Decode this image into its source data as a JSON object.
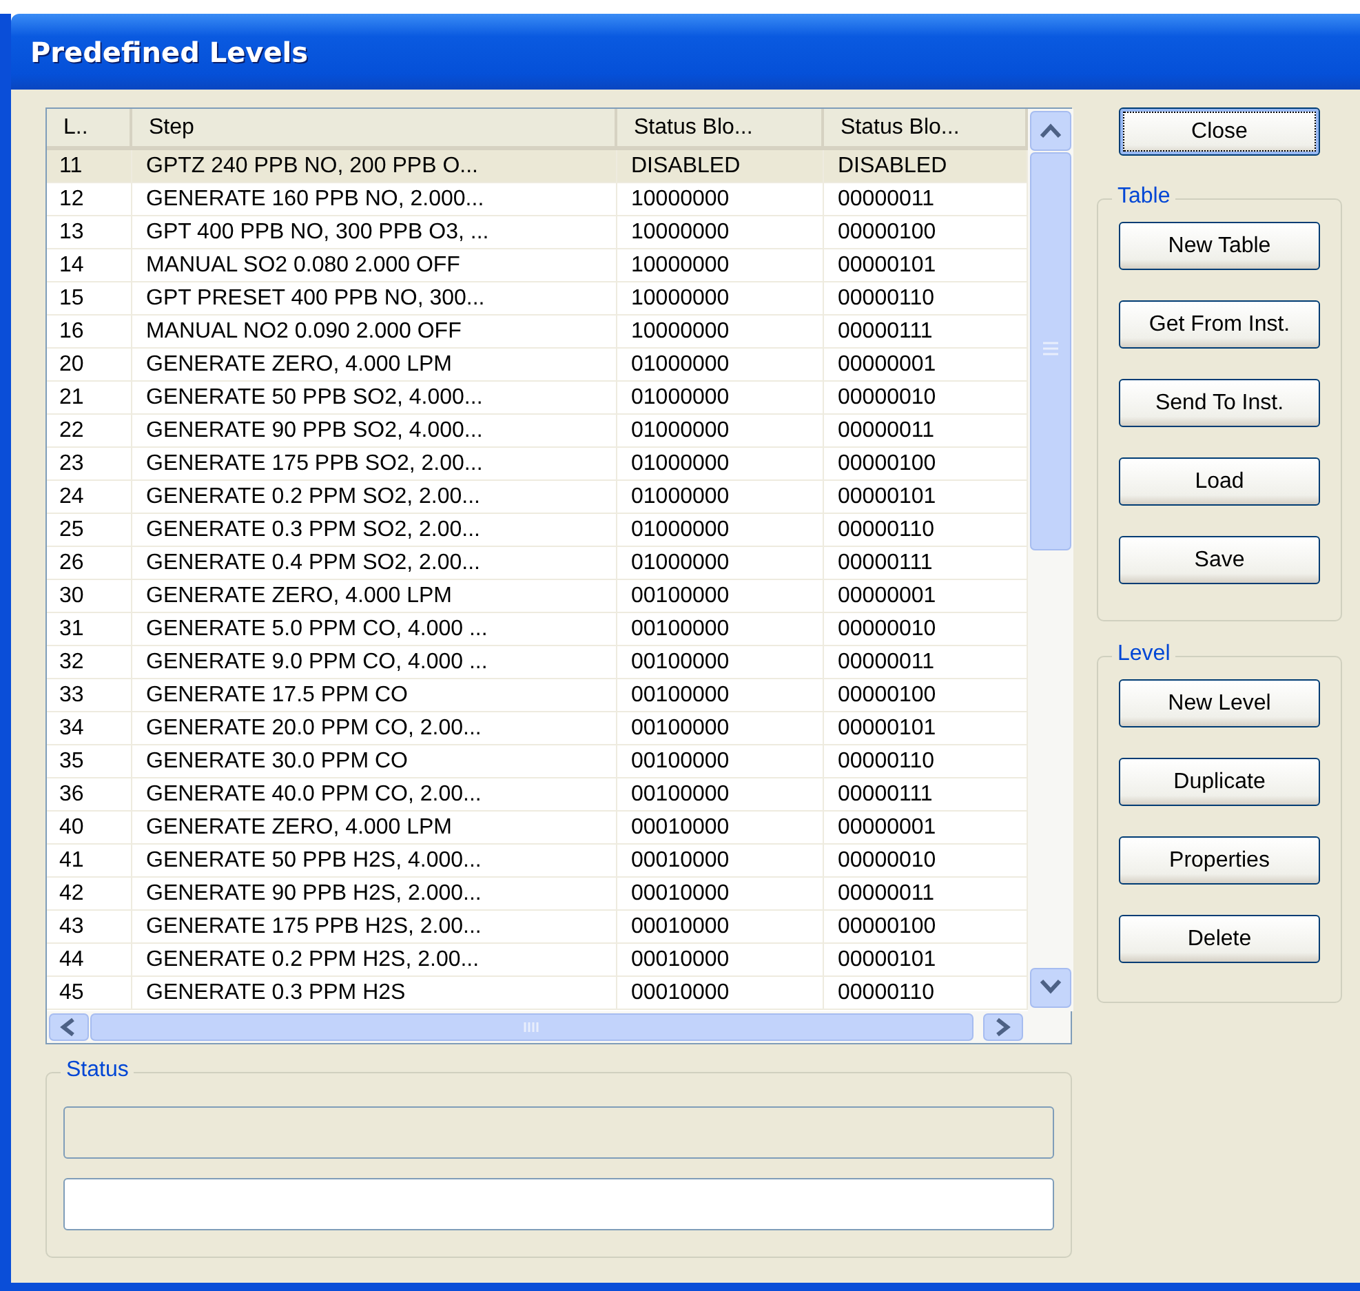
{
  "window": {
    "title": "Predefined Levels"
  },
  "table": {
    "columns": [
      "L..",
      "Step",
      "Status Blo...",
      "Status Blo..."
    ],
    "rows": [
      {
        "num": "11",
        "step": "GPTZ 240 PPB NO, 200 PPB O...",
        "status_1": "DISABLED",
        "status_2": "DISABLED",
        "selected": true
      },
      {
        "num": "12",
        "step": "GENERATE 160 PPB NO, 2.000...",
        "status_1": "10000000",
        "status_2": "00000011",
        "selected": false
      },
      {
        "num": "13",
        "step": "GPT 400 PPB NO, 300 PPB O3, ...",
        "status_1": "10000000",
        "status_2": "00000100",
        "selected": false
      },
      {
        "num": "14",
        "step": "MANUAL SO2 0.080 2.000 OFF",
        "status_1": "10000000",
        "status_2": "00000101",
        "selected": false
      },
      {
        "num": "15",
        "step": "GPT PRESET 400 PPB NO, 300...",
        "status_1": "10000000",
        "status_2": "00000110",
        "selected": false
      },
      {
        "num": "16",
        "step": "MANUAL NO2 0.090 2.000 OFF",
        "status_1": "10000000",
        "status_2": "00000111",
        "selected": false
      },
      {
        "num": "20",
        "step": "GENERATE ZERO, 4.000 LPM",
        "status_1": "01000000",
        "status_2": "00000001",
        "selected": false
      },
      {
        "num": "21",
        "step": "GENERATE 50 PPB SO2, 4.000...",
        "status_1": "01000000",
        "status_2": "00000010",
        "selected": false
      },
      {
        "num": "22",
        "step": "GENERATE 90 PPB SO2, 4.000...",
        "status_1": "01000000",
        "status_2": "00000011",
        "selected": false
      },
      {
        "num": "23",
        "step": "GENERATE 175 PPB SO2, 2.00...",
        "status_1": "01000000",
        "status_2": "00000100",
        "selected": false
      },
      {
        "num": "24",
        "step": "GENERATE 0.2 PPM SO2, 2.00...",
        "status_1": "01000000",
        "status_2": "00000101",
        "selected": false
      },
      {
        "num": "25",
        "step": "GENERATE 0.3 PPM SO2, 2.00...",
        "status_1": "01000000",
        "status_2": "00000110",
        "selected": false
      },
      {
        "num": "26",
        "step": "GENERATE 0.4 PPM SO2, 2.00...",
        "status_1": "01000000",
        "status_2": "00000111",
        "selected": false
      },
      {
        "num": "30",
        "step": "GENERATE ZERO, 4.000 LPM",
        "status_1": "00100000",
        "status_2": "00000001",
        "selected": false
      },
      {
        "num": "31",
        "step": "GENERATE 5.0 PPM CO, 4.000 ...",
        "status_1": "00100000",
        "status_2": "00000010",
        "selected": false
      },
      {
        "num": "32",
        "step": "GENERATE 9.0 PPM CO, 4.000 ...",
        "status_1": "00100000",
        "status_2": "00000011",
        "selected": false
      },
      {
        "num": "33",
        "step": "GENERATE 17.5 PPM CO",
        "status_1": "00100000",
        "status_2": "00000100",
        "selected": false
      },
      {
        "num": "34",
        "step": "GENERATE 20.0 PPM CO, 2.00...",
        "status_1": "00100000",
        "status_2": "00000101",
        "selected": false
      },
      {
        "num": "35",
        "step": "GENERATE 30.0 PPM CO",
        "status_1": "00100000",
        "status_2": "00000110",
        "selected": false
      },
      {
        "num": "36",
        "step": "GENERATE 40.0 PPM CO, 2.00...",
        "status_1": "00100000",
        "status_2": "00000111",
        "selected": false
      },
      {
        "num": "40",
        "step": "GENERATE ZERO, 4.000 LPM",
        "status_1": "00010000",
        "status_2": "00000001",
        "selected": false
      },
      {
        "num": "41",
        "step": "GENERATE 50 PPB H2S, 4.000...",
        "status_1": "00010000",
        "status_2": "00000010",
        "selected": false
      },
      {
        "num": "42",
        "step": "GENERATE 90 PPB H2S, 2.000...",
        "status_1": "00010000",
        "status_2": "00000011",
        "selected": false
      },
      {
        "num": "43",
        "step": "GENERATE 175 PPB H2S, 2.00...",
        "status_1": "00010000",
        "status_2": "00000100",
        "selected": false
      },
      {
        "num": "44",
        "step": "GENERATE 0.2 PPM H2S, 2.00...",
        "status_1": "00010000",
        "status_2": "00000101",
        "selected": false
      },
      {
        "num": "45",
        "step": "GENERATE 0.3 PPM H2S",
        "status_1": "00010000",
        "status_2": "00000110",
        "selected": false
      }
    ]
  },
  "status": {
    "title": "Status",
    "fields": [
      {
        "disabled": true
      },
      {
        "disabled": false
      }
    ]
  },
  "close_button": {
    "label": "Close",
    "focused": true
  },
  "groups": [
    {
      "title": "Table",
      "buttons": [
        {
          "label": "New Table",
          "focused": false
        },
        {
          "label": "Get From Inst.",
          "focused": false
        },
        {
          "label": "Send To Inst.",
          "focused": false
        },
        {
          "label": "Load",
          "focused": false
        },
        {
          "label": "Save",
          "focused": false
        }
      ]
    },
    {
      "title": "Level",
      "buttons": [
        {
          "label": "New Level",
          "focused": false
        },
        {
          "label": "Duplicate",
          "focused": false
        },
        {
          "label": "Properties",
          "focused": false
        },
        {
          "label": "Delete",
          "focused": false
        }
      ]
    }
  ]
}
